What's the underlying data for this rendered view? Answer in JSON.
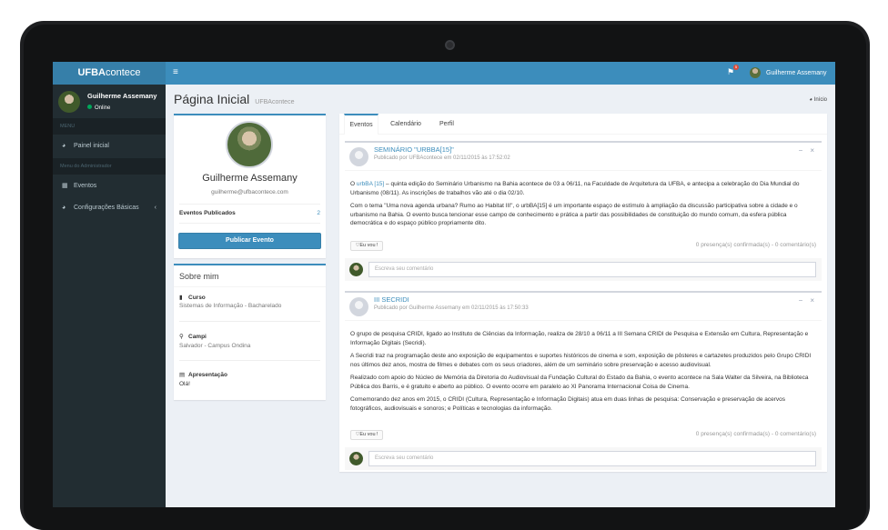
{
  "header": {
    "logo_bold": "UFBA",
    "logo_rest": "contece",
    "menu_icon": "hamburger-icon",
    "notification_count": "5",
    "user_name": "Guilherme Assemany"
  },
  "sidebar": {
    "user_name": "Guilherme Assemany",
    "status": "Online",
    "header_menu": "MENU",
    "item_painel": "Painel inicial",
    "header_admin": "Menu do Administrador",
    "item_eventos": "Eventos",
    "item_config": "Configurações Básicas"
  },
  "page": {
    "title": "Página Inicial",
    "subtitle": "UFBAcontece",
    "breadcrumb": "Início"
  },
  "profile": {
    "name": "Guilherme Assemany",
    "email": "guilherme@ufbacontece.com",
    "published_label": "Eventos Publicados",
    "published_count": "2",
    "publish_button": "Publicar Evento"
  },
  "about": {
    "title": "Sobre mim",
    "course_label": "Curso",
    "course_value": "Sistemas de Informação - Bacharelado",
    "campus_label": "Campi",
    "campus_value": "Salvador - Campus Ondina",
    "intro_label": "Apresentação",
    "intro_value": "Olá!"
  },
  "tabs": [
    "Eventos",
    "Calendário",
    "Perfil"
  ],
  "posts": [
    {
      "title": "SEMINÁRIO \"URBBA[15]\"",
      "meta": "Publicado por UFBAcontece em 02/11/2015 às 17:52:02",
      "p1_link": "urbBA [15]",
      "p1_pre": "O ",
      "p1_post": " – quinta edição do Seminário Urbanismo na Bahia acontece  de 03 a 06/11, na Faculdade de Arquitetura da UFBA, e antecipa a celebração do Dia Mundial do Urbanismo (08/11). As inscrições de trabalhos vão até o dia 02/10.",
      "p2": "Com o tema \"Uma nova agenda urbana? Rumo ao Habitat III\", o urbBA[15] é um importante espaço de estímulo à ampliação da discussão participativa sobre a cidade e o urbanismo na Bahia. O evento busca tencionar esse campo de conhecimento e prática a partir das possibilidades de constituição do mundo comum, da esfera pública democrática e do espaço público propriamente dito.",
      "like": "Eu vou !",
      "stats": "0 presença(s) confirmada(s) - 0 comentário(s)",
      "comment_placeholder": "Escreva seu comentário"
    },
    {
      "title": "III SECRIDI",
      "meta": "Publicado por Guilherme Assemany em 02/11/2015 às 17:50:33",
      "p1": "O grupo de pesquisa CRIDI, ligado ao Instituto de Ciências da Informação, realiza de 28/10 a 06/11 a III Semana CRIDI de Pesquisa e Extensão em Cultura, Representação e Informação Digitais (Secridi).",
      "p2": "A Secridi traz na programação deste ano exposição de equipamentos e suportes históricos de cinema e som, exposição de pôsteres e cartazetes produzidos pelo Grupo CRIDI nos últimos dez anos, mostra de filmes e debates com os seus criadores, além de um seminário sobre preservação e acesso audiovisual.",
      "p3": "Realizado com apoio do Núcleo de Memória da Diretoria do Audiovisual da Fundação Cultural do Estado da Bahia, o evento acontece na Sala Walter da Silveira, na Biblioteca Pública dos Barris, e é gratuito e aberto ao público. O evento ocorre em paralelo ao XI Panorama Internacional Coisa de Cinema.",
      "p4": "Comemorando dez anos em 2015, o CRIDI (Cultura, Representação e Informação Digitais) atua em duas linhas de pesquisa: Conservação e preservação de acervos fotográficos, audiovisuais e sonoros; e Políticas e tecnologias da informação.",
      "like": "Eu vou !",
      "stats": "0 presença(s) confirmada(s) - 0 comentário(s)",
      "comment_placeholder": "Escreva seu comentário"
    }
  ],
  "colors": {
    "primary": "#3c8dbc",
    "sidebar": "#222d32",
    "online": "#00a65a"
  }
}
